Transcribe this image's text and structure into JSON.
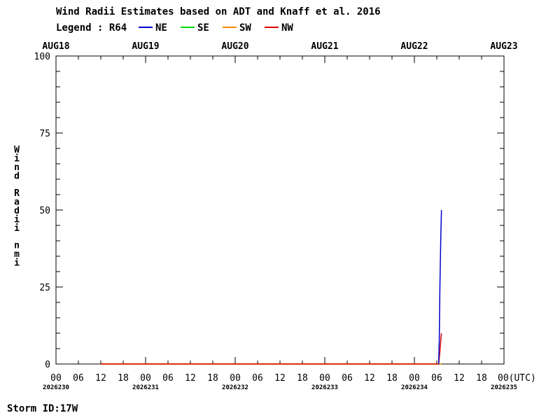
{
  "chart_data": {
    "type": "line",
    "title": "Wind Radii Estimates based on ADT and Knaff et al. 2016",
    "legend": {
      "label": "Legend : R64",
      "placement": "top",
      "entries": [
        {
          "name": "NE",
          "color": "#0000cc"
        },
        {
          "name": "SE",
          "color": "#00dd00"
        },
        {
          "name": "SW",
          "color": "#ff8800"
        },
        {
          "name": "NW",
          "color": "#dd0000"
        }
      ]
    },
    "ylabel": "Wind Radii nmi",
    "ylim": [
      0,
      100
    ],
    "yticks": [
      0,
      25,
      50,
      75,
      100
    ],
    "xlim": [
      "2026-08-18T00:00",
      "2026-08-23T00:00"
    ],
    "top_axis_labels": [
      "AUG18",
      "AUG19",
      "AUG20",
      "AUG21",
      "AUG22",
      "AUG23"
    ],
    "bottom_hour_labels": [
      "00",
      "06",
      "12",
      "18",
      "00",
      "06",
      "12",
      "18",
      "00",
      "06",
      "12",
      "18",
      "00",
      "06",
      "12",
      "18",
      "00",
      "06",
      "12",
      "18",
      "00(UTC)"
    ],
    "julian_labels": [
      "2026230",
      "2026231",
      "2026232",
      "2026233",
      "2026234",
      "2026235"
    ],
    "series": [
      {
        "name": "NE",
        "color": "#0000cc",
        "points": [
          {
            "x": "2026-08-22T06:30",
            "y": 0
          },
          {
            "x": "2026-08-22T06:40",
            "y": 8
          },
          {
            "x": "2026-08-22T06:50",
            "y": 25
          },
          {
            "x": "2026-08-22T07:05",
            "y": 42
          },
          {
            "x": "2026-08-22T07:15",
            "y": 50
          }
        ]
      },
      {
        "name": "SE",
        "color": "#00dd00",
        "points": [
          {
            "x": "2026-08-18T12:00",
            "y": 0
          },
          {
            "x": "2026-08-22T07:15",
            "y": 0
          }
        ]
      },
      {
        "name": "SW",
        "color": "#ff8800",
        "points": [
          {
            "x": "2026-08-18T12:00",
            "y": 0
          },
          {
            "x": "2026-08-22T07:15",
            "y": 0
          }
        ]
      },
      {
        "name": "NW",
        "color": "#dd0000",
        "points": [
          {
            "x": "2026-08-18T12:00",
            "y": 0
          },
          {
            "x": "2026-08-22T06:30",
            "y": 0
          },
          {
            "x": "2026-08-22T06:50",
            "y": 4
          },
          {
            "x": "2026-08-22T07:05",
            "y": 8
          },
          {
            "x": "2026-08-22T07:15",
            "y": 10
          }
        ]
      }
    ],
    "footer": "Storm ID:17W"
  }
}
